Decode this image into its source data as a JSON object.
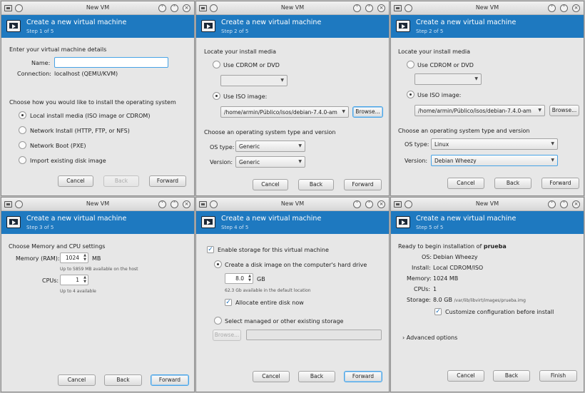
{
  "common": {
    "window_title": "New VM",
    "banner_title": "Create a new virtual machine",
    "cancel": "Cancel",
    "back": "Back",
    "forward": "Forward",
    "finish": "Finish",
    "help_glyph": "?",
    "min_glyph": "˅",
    "max_glyph": "˄",
    "close_glyph": "×",
    "accent": "#1e79c0",
    "icons": {
      "app": "vm-manager-icon",
      "banner": "vm-screen-icon"
    }
  },
  "w1": {
    "step": "Step 1 of 5",
    "heading": "Enter your virtual machine details",
    "name_label": "Name:",
    "name_value": "",
    "connection_label": "Connection:",
    "connection_value": "localhost (QEMU/KVM)",
    "install_heading": "Choose how you would like to install the operating system",
    "options": [
      "Local install media (ISO image or CDROM)",
      "Network Install (HTTP, FTP, or NFS)",
      "Network Boot (PXE)",
      "Import existing disk image"
    ],
    "selected": 0
  },
  "w2": {
    "step": "Step 2 of 5",
    "heading": "Locate your install media",
    "cdrom_label": "Use CDROM or DVD",
    "iso_label": "Use ISO image:",
    "iso_path": "/home/armin/Público/isos/debian-7.4.0-am",
    "browse": "Browse...",
    "os_heading": "Choose an operating system type and version",
    "os_type_label": "OS type:",
    "os_type_value": "Generic",
    "version_label": "Version:",
    "version_value": "Generic"
  },
  "w3": {
    "step": "Step 2 of 5",
    "heading": "Locate your install media",
    "cdrom_label": "Use CDROM or DVD",
    "iso_label": "Use ISO image:",
    "iso_path": "/home/armin/Público/isos/debian-7.4.0-am",
    "browse": "Browse...",
    "os_heading": "Choose an operating system type and version",
    "os_type_label": "OS type:",
    "os_type_value": "Linux",
    "version_label": "Version:",
    "version_value": "Debian Wheezy"
  },
  "w4": {
    "step": "Step 3 of 5",
    "heading": "Choose Memory and CPU settings",
    "memory_label": "Memory (RAM):",
    "memory_value": "1024",
    "memory_unit": "MB",
    "memory_hint": "Up to 5859 MB available on the host",
    "cpus_label": "CPUs:",
    "cpus_value": "1",
    "cpus_hint": "Up to 4 available"
  },
  "w5": {
    "step": "Step 4 of 5",
    "enable_storage": "Enable storage for this virtual machine",
    "create_disk": "Create a disk image on the computer's hard drive",
    "size_value": "8.0",
    "size_unit": "GB",
    "available": "62.3 Gb available in the default location",
    "allocate": "Allocate entire disk now",
    "select_managed": "Select managed or other existing storage",
    "browse": "Browse..."
  },
  "w6": {
    "step": "Step 5 of 5",
    "ready_prefix": "Ready to begin installation of",
    "vm_name": "prueba",
    "rows": [
      {
        "label": "OS:",
        "value": "Debian Wheezy"
      },
      {
        "label": "Install:",
        "value": "Local CDROM/ISO"
      },
      {
        "label": "Memory:",
        "value": "1024 MB"
      },
      {
        "label": "CPUs:",
        "value": "1"
      }
    ],
    "storage_label": "Storage:",
    "storage_size": "8.0 GB",
    "storage_path": "/var/lib/libvirt/images/prueba.img",
    "customize": "Customize configuration before install",
    "advanced": "Advanced options",
    "expander_glyph": "›"
  }
}
